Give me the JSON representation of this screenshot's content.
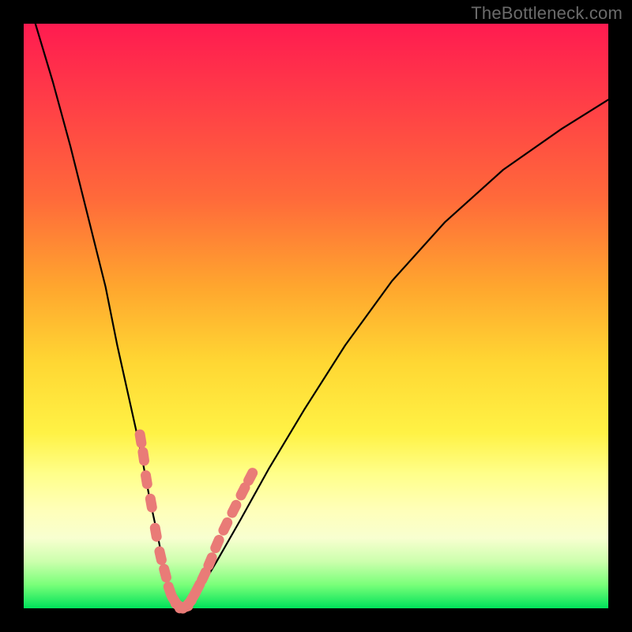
{
  "watermark": "TheBottleneck.com",
  "chart_data": {
    "type": "line",
    "title": "",
    "xlabel": "",
    "ylabel": "",
    "xlim": [
      0,
      100
    ],
    "ylim": [
      0,
      100
    ],
    "grid": false,
    "legend": false,
    "note": "V-shaped bottleneck curve over rainbow gradient; axes unlabeled; values estimated from pixel position on a 0–100 normalized scale.",
    "series": [
      {
        "name": "bottleneck-curve",
        "x": [
          2,
          5,
          8,
          11,
          14,
          16,
          18,
          20,
          21.5,
          23,
          24,
          25,
          26,
          27,
          28,
          30,
          33,
          37,
          42,
          48,
          55,
          63,
          72,
          82,
          92,
          100
        ],
        "y": [
          100,
          90,
          79,
          67,
          55,
          45,
          36,
          27,
          19,
          12,
          7,
          3,
          0.5,
          0,
          0.5,
          3,
          8,
          15,
          24,
          34,
          45,
          56,
          66,
          75,
          82,
          87
        ]
      }
    ],
    "markers": {
      "name": "highlight-beads",
      "color": "#e97b77",
      "points": [
        {
          "x": 20.0,
          "y": 29
        },
        {
          "x": 20.5,
          "y": 26
        },
        {
          "x": 21.0,
          "y": 22
        },
        {
          "x": 21.8,
          "y": 18
        },
        {
          "x": 22.6,
          "y": 13
        },
        {
          "x": 23.4,
          "y": 9
        },
        {
          "x": 24.2,
          "y": 6
        },
        {
          "x": 25.0,
          "y": 3
        },
        {
          "x": 25.8,
          "y": 1.3
        },
        {
          "x": 26.6,
          "y": 0.4
        },
        {
          "x": 27.4,
          "y": 0.2
        },
        {
          "x": 28.2,
          "y": 0.8
        },
        {
          "x": 29.0,
          "y": 2
        },
        {
          "x": 29.8,
          "y": 3.5
        },
        {
          "x": 30.8,
          "y": 5.5
        },
        {
          "x": 31.9,
          "y": 8
        },
        {
          "x": 33.1,
          "y": 11
        },
        {
          "x": 34.5,
          "y": 14
        },
        {
          "x": 36.0,
          "y": 17
        },
        {
          "x": 37.5,
          "y": 20
        },
        {
          "x": 38.8,
          "y": 22.5
        }
      ]
    }
  }
}
